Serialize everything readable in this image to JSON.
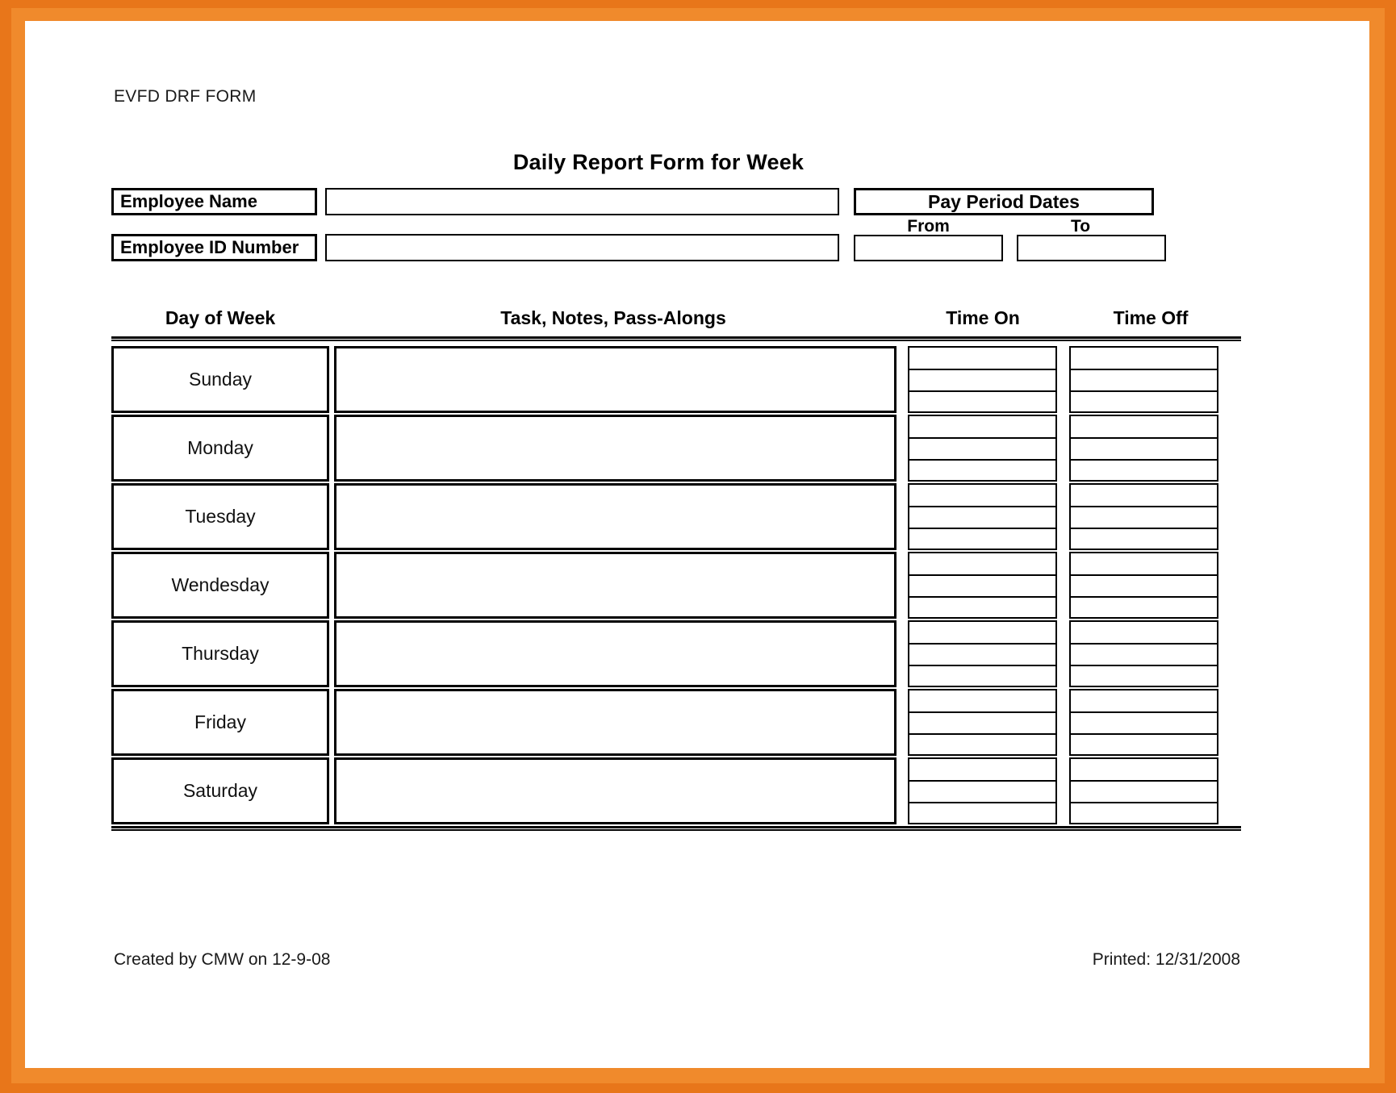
{
  "document": {
    "form_code": "EVFD DRF FORM",
    "title": "Daily Report Form for Week"
  },
  "identity": {
    "employee_name_label": "Employee Name",
    "employee_name_value": "",
    "employee_id_label": "Employee ID Number",
    "employee_id_value": "",
    "pay_period_header": "Pay Period Dates",
    "from_label": "From",
    "to_label": "To",
    "from_value": "",
    "to_value": ""
  },
  "table": {
    "columns": [
      "Day of Week",
      "Task, Notes, Pass-Alongs",
      "Time On",
      "Time Off"
    ],
    "rows": [
      {
        "day": "Sunday",
        "task": "",
        "time_on": "",
        "time_off": ""
      },
      {
        "day": "Monday",
        "task": "",
        "time_on": "",
        "time_off": ""
      },
      {
        "day": "Tuesday",
        "task": "",
        "time_on": "",
        "time_off": ""
      },
      {
        "day": "Wendesday",
        "task": "",
        "time_on": "",
        "time_off": ""
      },
      {
        "day": "Thursday",
        "task": "",
        "time_on": "",
        "time_off": ""
      },
      {
        "day": "Friday",
        "task": "",
        "time_on": "",
        "time_off": ""
      },
      {
        "day": "Saturday",
        "task": "",
        "time_on": "",
        "time_off": ""
      }
    ]
  },
  "footer": {
    "created_by": "Created by CMW on 12-9-08",
    "printed": "Printed: 12/31/2008"
  },
  "colors": {
    "scan_border_outer": "#e8761a",
    "scan_border_inner": "#f08a2c",
    "paper": "#ffffff",
    "ink": "#000000"
  }
}
